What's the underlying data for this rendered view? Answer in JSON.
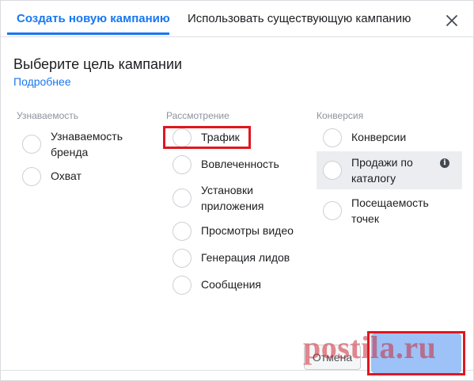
{
  "tabs": {
    "create_new": "Создать новую кампанию",
    "use_existing": "Использовать существующую кампанию"
  },
  "header": {
    "title": "Выберите цель кампании",
    "learn_more": "Подробнее"
  },
  "columns": [
    {
      "title": "Узнаваемость",
      "options": [
        "Узнаваемость бренда",
        "Охват"
      ]
    },
    {
      "title": "Рассмотрение",
      "options": [
        "Трафик",
        "Вовлеченность",
        "Установки приложения",
        "Просмотры видео",
        "Генерация лидов",
        "Сообщения"
      ]
    },
    {
      "title": "Конверсия",
      "options": [
        "Конверсии",
        "Продажи по каталогу",
        "Посещаемость точек"
      ]
    }
  ],
  "footer": {
    "cancel": "Отмена"
  },
  "watermark": "postila.ru",
  "colors": {
    "accent": "#1877f2",
    "highlight": "#e0171f",
    "continue_disabled": "#9cc2f8"
  },
  "icons": {
    "close": "close-icon",
    "info": "info-icon"
  }
}
